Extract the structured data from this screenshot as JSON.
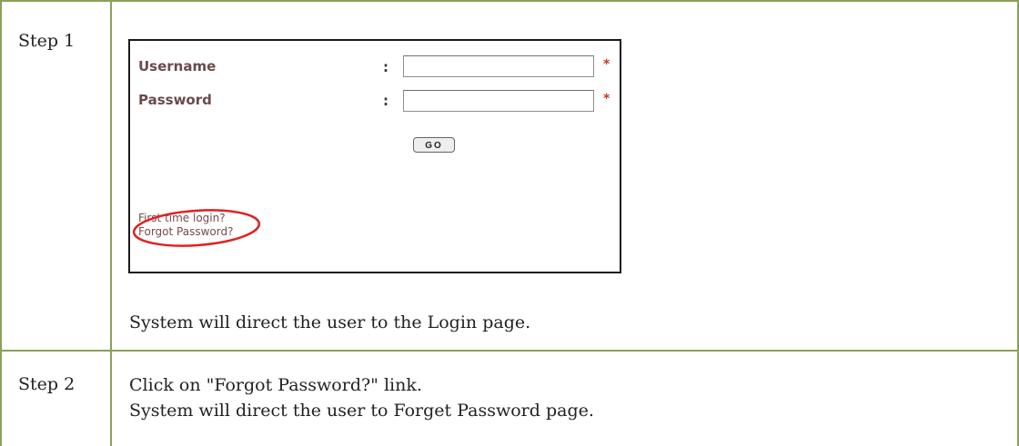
{
  "steps": [
    {
      "label": "Step 1",
      "description": "System will direct the user to the Login page."
    },
    {
      "label": "Step 2",
      "line1": "Click on \"Forgot Password?\" link.",
      "line2": "System will direct the user to Forget Password page."
    }
  ],
  "login": {
    "username_label": "Username",
    "password_label": "Password",
    "colon": ":",
    "required_mark": "*",
    "go_label": "GO",
    "first_time_link": "First time login?",
    "forgot_link": "Forgot Password?",
    "highlight_color": "#e02020"
  }
}
